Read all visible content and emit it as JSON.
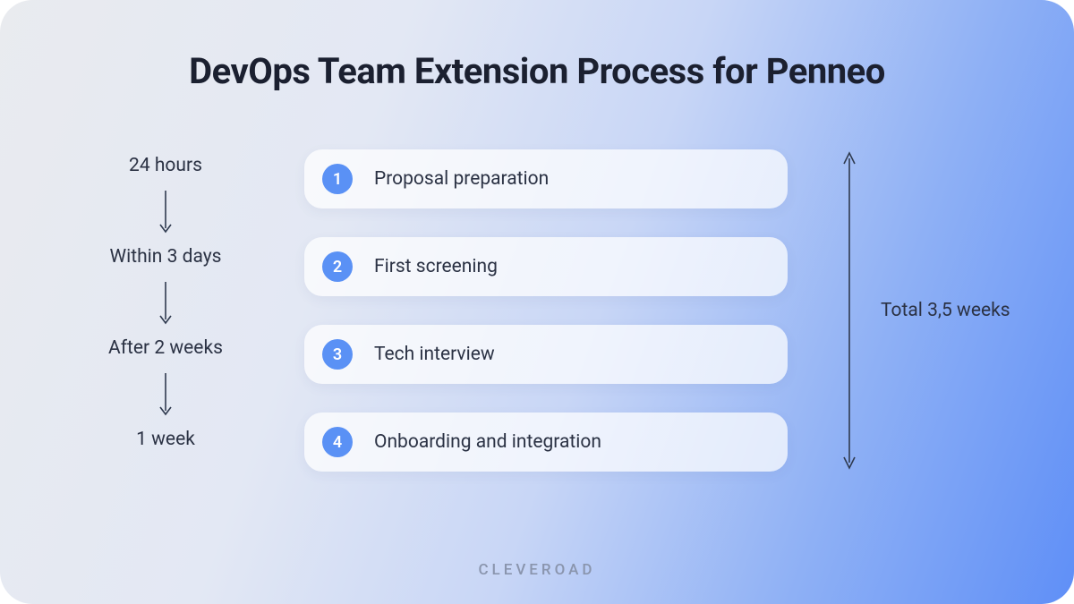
{
  "title": "DevOps Team Extension Process for Penneo",
  "timeline": [
    "24 hours",
    "Within 3 days",
    "After 2 weeks",
    "1 week"
  ],
  "steps": [
    {
      "num": "1",
      "label": "Proposal preparation"
    },
    {
      "num": "2",
      "label": "First screening"
    },
    {
      "num": "3",
      "label": "Tech interview"
    },
    {
      "num": "4",
      "label": "Onboarding and integration"
    }
  ],
  "total": "Total 3,5 weeks",
  "brand": "CLEVEROAD",
  "colors": {
    "badge": "#5a91f5",
    "text": "#2b3244",
    "arrow": "#2f3a4f"
  }
}
